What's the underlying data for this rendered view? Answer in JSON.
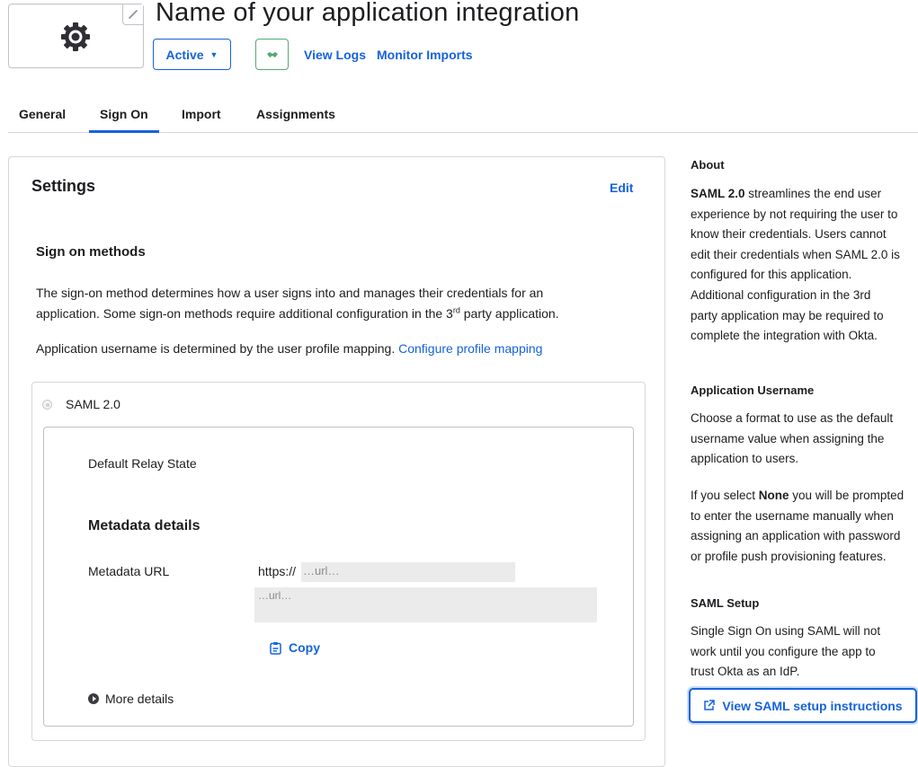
{
  "app": {
    "title": "Name of your application integration",
    "status_label": "Active",
    "logo_icon": "gear-icon",
    "view_logs": "View Logs",
    "monitor_imports": "Monitor Imports"
  },
  "tabs": [
    {
      "label": "General",
      "active": false
    },
    {
      "label": "Sign On",
      "active": true
    },
    {
      "label": "Import",
      "active": false
    },
    {
      "label": "Assignments",
      "active": false
    }
  ],
  "settings": {
    "title": "Settings",
    "edit_label": "Edit",
    "sign_on_methods": {
      "heading": "Sign on methods",
      "description_line1": "The sign-on method determines how a user signs into and manages their credentials for an",
      "description_line2_pre": "application. Some sign-on methods require additional configuration in the 3",
      "description_line2_sup": "rd",
      "description_line2_post": " party application.",
      "username_text": "Application username is determined by the user profile mapping.",
      "configure_link": "Configure profile mapping"
    },
    "saml": {
      "option_label": "SAML 2.0",
      "default_relay_state_label": "Default Relay State",
      "metadata_heading": "Metadata details",
      "metadata_url_label": "Metadata URL",
      "metadata_url_prefix": "https://",
      "metadata_url_placeholder1": "…url…",
      "metadata_url_placeholder2": "…url…",
      "copy_label": "Copy",
      "more_details_label": "More details"
    }
  },
  "sidebar": {
    "about": {
      "heading": "About",
      "lines_bold": "SAML 2.0",
      "line1_rest": " streamlines the end user",
      "lines": [
        "experience by not requiring the user to",
        "know their credentials. Users cannot",
        "edit their credentials when SAML 2.0 is",
        "configured for this application.",
        "Additional configuration in the 3rd",
        "party application may be required to",
        "complete the integration with Okta."
      ]
    },
    "app_username": {
      "heading": "Application Username",
      "lines": [
        "Choose a format to use as the default",
        "username value when assigning the",
        "application to users."
      ],
      "p2_pre": "If you select ",
      "p2_bold": "None",
      "p2_post": " you will be prompted",
      "p2_lines": [
        "to enter the username manually when",
        "assigning an application with password",
        "or profile push provisioning features."
      ]
    },
    "saml_setup": {
      "heading": "SAML Setup",
      "lines": [
        "Single Sign On using SAML will not",
        "work until you configure the app to",
        "trust Okta as an IdP."
      ],
      "button_label": "View SAML setup instructions"
    }
  },
  "colors": {
    "link_blue": "#1662dd",
    "push_green": "#55a874",
    "border": "#d7d7dc"
  }
}
